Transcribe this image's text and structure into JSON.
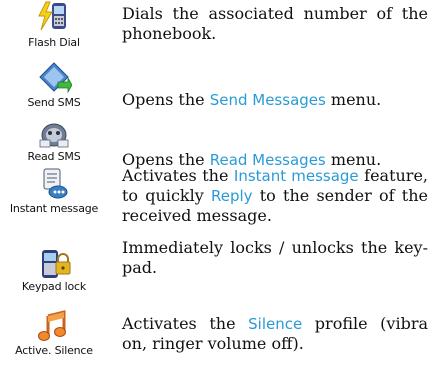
{
  "colors": {
    "keyword": "#2a9bd6",
    "text": "#111111"
  },
  "entries": [
    {
      "icon": "flash-dial-icon",
      "label": "Flash Dial",
      "desc": {
        "t1": "Dials the associated number of the phonebook."
      }
    },
    {
      "icon": "send-sms-icon",
      "label": "Send SMS",
      "desc": {
        "t1": "Opens the ",
        "kw1": "Send Messages",
        "t2": " menu."
      }
    },
    {
      "icon": "read-sms-icon",
      "label": "Read SMS",
      "desc": {
        "t1": "Opens the ",
        "kw1": "Read Messages",
        "t2": " menu."
      }
    },
    {
      "icon": "instant-message-icon",
      "label": "Instant message",
      "desc": {
        "t1": "Activates the ",
        "kw1": "Instant message",
        "t2": " feature, to quickly ",
        "kw2": "Reply",
        "t3": " to the sender of the received message."
      }
    },
    {
      "icon": "keypad-lock-icon",
      "label": "Keypad lock",
      "desc": {
        "t1": "Immediately locks / unlocks the key-pad."
      }
    },
    {
      "icon": "silence-icon",
      "label": "Active. Silence",
      "desc": {
        "t1": "Activates the ",
        "kw1": "Silence",
        "t2": " profile (vibra on, ringer volume off)."
      }
    }
  ]
}
